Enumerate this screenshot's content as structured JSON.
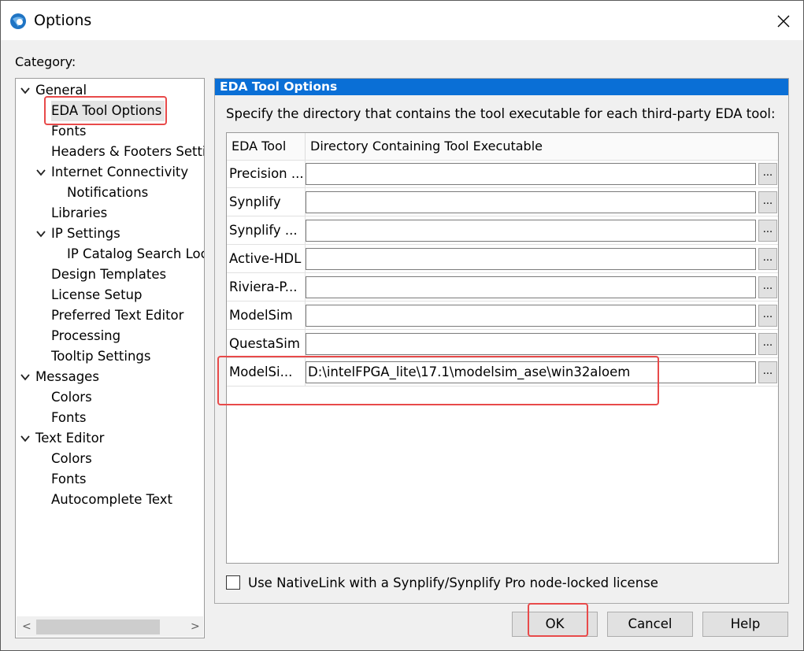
{
  "window": {
    "title": "Options",
    "icon": "app-sphere-icon",
    "close_icon": "close-icon"
  },
  "category_label": "Category:",
  "tree": [
    {
      "label": "General",
      "indent": 0,
      "expandable": true
    },
    {
      "label": "EDA Tool Options",
      "indent": 1,
      "expandable": false,
      "selected": true
    },
    {
      "label": "Fonts",
      "indent": 1,
      "expandable": false
    },
    {
      "label": "Headers & Footers Settings",
      "indent": 1,
      "expandable": false
    },
    {
      "label": "Internet Connectivity",
      "indent": 1,
      "expandable": true
    },
    {
      "label": "Notifications",
      "indent": 2,
      "expandable": false
    },
    {
      "label": "Libraries",
      "indent": 1,
      "expandable": false
    },
    {
      "label": "IP Settings",
      "indent": 1,
      "expandable": true
    },
    {
      "label": "IP Catalog Search Locations",
      "indent": 2,
      "expandable": false
    },
    {
      "label": "Design Templates",
      "indent": 1,
      "expandable": false
    },
    {
      "label": "License Setup",
      "indent": 1,
      "expandable": false
    },
    {
      "label": "Preferred Text Editor",
      "indent": 1,
      "expandable": false
    },
    {
      "label": "Processing",
      "indent": 1,
      "expandable": false
    },
    {
      "label": "Tooltip Settings",
      "indent": 1,
      "expandable": false
    },
    {
      "label": "Messages",
      "indent": 0,
      "expandable": true
    },
    {
      "label": "Colors",
      "indent": 1,
      "expandable": false
    },
    {
      "label": "Fonts",
      "indent": 1,
      "expandable": false
    },
    {
      "label": "Text Editor",
      "indent": 0,
      "expandable": true
    },
    {
      "label": "Colors",
      "indent": 1,
      "expandable": false
    },
    {
      "label": "Fonts",
      "indent": 1,
      "expandable": false
    },
    {
      "label": "Autocomplete Text",
      "indent": 1,
      "expandable": false
    }
  ],
  "panel": {
    "header": "EDA Tool Options",
    "description": "Specify the directory that contains the tool executable for each third-party EDA tool:",
    "columns": [
      "EDA Tool",
      "Directory Containing Tool Executable"
    ],
    "rows": [
      {
        "tool": "Precision ...",
        "dir": ""
      },
      {
        "tool": "Synplify",
        "dir": ""
      },
      {
        "tool": "Synplify ...",
        "dir": ""
      },
      {
        "tool": "Active-HDL",
        "dir": ""
      },
      {
        "tool": "Riviera-P...",
        "dir": ""
      },
      {
        "tool": "ModelSim",
        "dir": ""
      },
      {
        "tool": "QuestaSim",
        "dir": ""
      },
      {
        "tool": "ModelSi...",
        "dir": "D:\\intelFPGA_lite\\17.1\\modelsim_ase\\win32aloem"
      }
    ],
    "browse_label": "...",
    "checkbox_label": "Use NativeLink with a Synplify/Synplify Pro node-locked license",
    "checkbox_checked": false
  },
  "buttons": {
    "ok": "OK",
    "cancel": "Cancel",
    "help": "Help"
  },
  "scroll": {
    "left_arrow": "<",
    "right_arrow": ">"
  },
  "colors": {
    "header_blue": "#0a6fd6",
    "highlight_red": "#e84a4a"
  }
}
